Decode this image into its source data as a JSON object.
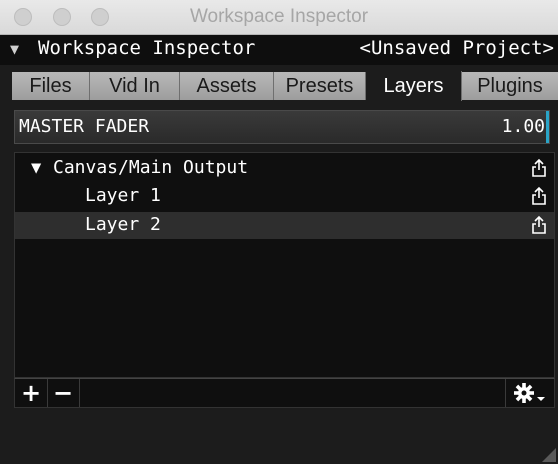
{
  "window": {
    "title": "Workspace Inspector"
  },
  "header": {
    "title": "Workspace Inspector",
    "project": "<Unsaved Project>"
  },
  "tabs": [
    {
      "label": "Files",
      "active": false
    },
    {
      "label": "Vid In",
      "active": false
    },
    {
      "label": "Assets",
      "active": false
    },
    {
      "label": "Presets",
      "active": false
    },
    {
      "label": "Layers",
      "active": true
    },
    {
      "label": "Plugins",
      "active": false
    }
  ],
  "master_fader": {
    "label": "MASTER FADER",
    "value": "1.00"
  },
  "tree": {
    "root": {
      "label": "Canvas/Main Output",
      "expanded": true
    },
    "layers": [
      {
        "label": "Layer 1",
        "selected": false
      },
      {
        "label": "Layer 2",
        "selected": true
      }
    ]
  },
  "bottom_bar": {
    "add": "+",
    "remove": "−",
    "settings_icon": "gear-icon"
  },
  "colors": {
    "accent": "#2aa5c8",
    "selected_row": "#2e2e2e"
  }
}
